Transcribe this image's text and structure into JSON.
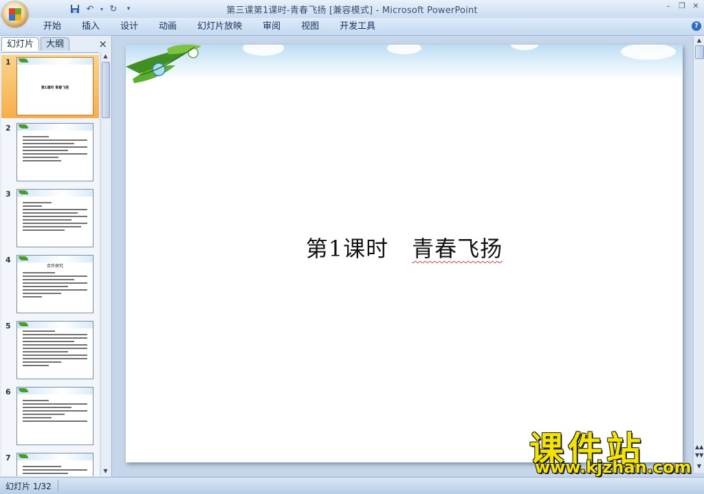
{
  "window": {
    "title": "第三课第1课时-青春飞扬 [兼容模式] - Microsoft PowerPoint"
  },
  "qat": {
    "save_icon": "save-icon",
    "undo_icon": "undo-icon",
    "redo_icon": "redo-icon",
    "customize_icon": "customize-icon"
  },
  "ribbon": {
    "tabs": [
      {
        "label": "开始"
      },
      {
        "label": "插入"
      },
      {
        "label": "设计"
      },
      {
        "label": "动画"
      },
      {
        "label": "幻灯片放映"
      },
      {
        "label": "审阅"
      },
      {
        "label": "视图"
      },
      {
        "label": "开发工具"
      }
    ],
    "help_icon": "help-icon"
  },
  "panel": {
    "tabs": [
      {
        "label": "幻灯片",
        "active": true
      },
      {
        "label": "大纲",
        "active": false
      }
    ],
    "close_label": "×"
  },
  "thumbnails": [
    {
      "number": "1",
      "selected": true,
      "title": "第1课时 青春飞扬"
    },
    {
      "number": "2",
      "selected": false
    },
    {
      "number": "3",
      "selected": false
    },
    {
      "number": "4",
      "selected": false,
      "heading": "合作探究"
    },
    {
      "number": "5",
      "selected": false
    },
    {
      "number": "6",
      "selected": false
    },
    {
      "number": "7",
      "selected": false
    }
  ],
  "slide": {
    "title_part1": "第1课时",
    "title_part2": "青春飞扬"
  },
  "status": {
    "slide_counter": "幻灯片 1/32"
  },
  "watermark": {
    "text_cn": "课件站",
    "url": "www.kjzhan.com"
  },
  "colors": {
    "ribbon_bg": "#c6d9f0",
    "selected_thumb": "#f7ae4b",
    "watermark": "#f5e400"
  }
}
